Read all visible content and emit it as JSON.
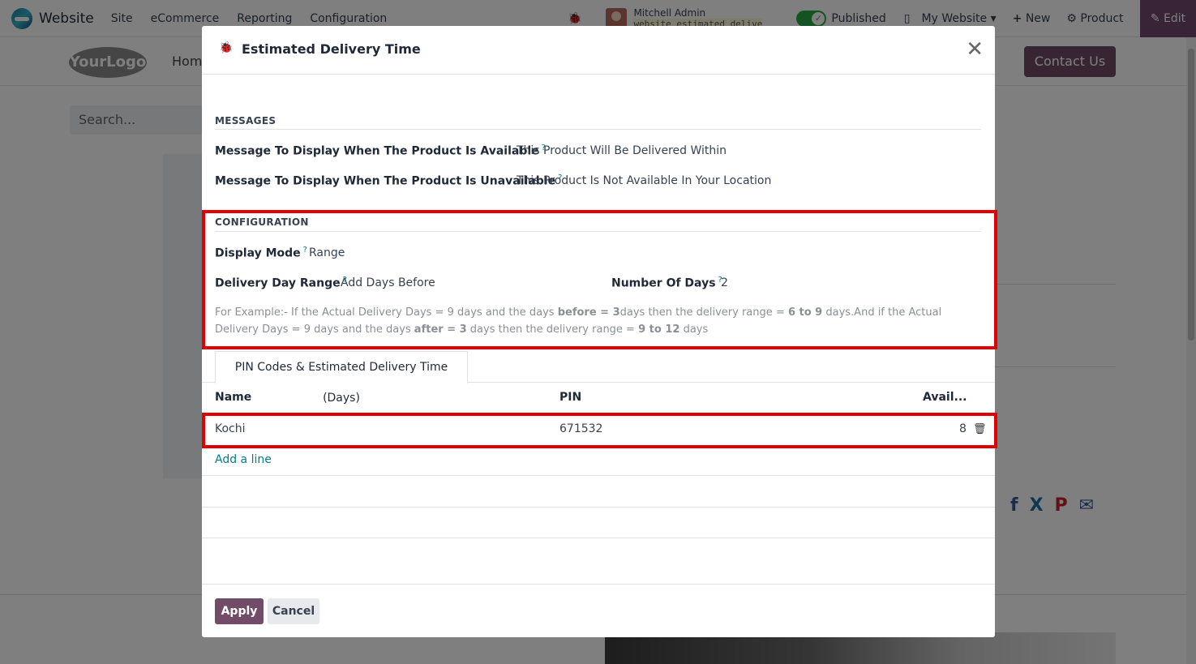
{
  "topbar": {
    "app_name": "Website",
    "menu": [
      "Site",
      "eCommerce",
      "Reporting",
      "Configuration"
    ],
    "user_name": "Mitchell Admin",
    "db_name": "website_estimated_delive",
    "published_label": "Published",
    "website_label": "My Website",
    "new_label": "New",
    "product_label": "Product",
    "edit_label": "Edit"
  },
  "site": {
    "logo_text": "YourLogo",
    "home_label": "Home",
    "contact_label": "Contact Us",
    "search_placeholder": "Search..."
  },
  "modal": {
    "title": "Estimated Delivery Time",
    "messages": {
      "section": "MESSAGES",
      "available_label": "Message To Display When The Product Is Available",
      "available_value": "This Product Will Be Delivered Within",
      "unavailable_label": "Message To Display When The Product Is Unavailable",
      "unavailable_value": "This Product Is Not Available In Your Location"
    },
    "configuration": {
      "section": "CONFIGURATION",
      "display_mode_label": "Display Mode",
      "display_mode_value": "Range",
      "day_range_label": "Delivery Day Range",
      "day_range_value": "Add Days Before",
      "num_days_label": "Number Of Days",
      "num_days_value": "2",
      "help_1": "For Example:- If the Actual Delivery Days = 9 days and the days ",
      "help_b1": "before = 3",
      "help_2": "days then the delivery range = ",
      "help_b2": "6 to 9",
      "help_3": " days.And if the Actual Delivery Days = 9 days and the days ",
      "help_b3": "after = 3",
      "help_4": " days then the delivery range = ",
      "help_b4": "9 to 12",
      "help_5": " days"
    },
    "tab_label": "PIN Codes & Estimated Delivery Time (Days)",
    "table": {
      "headers": [
        "Name",
        "PIN",
        "Avail..."
      ],
      "rows": [
        {
          "name": "Kochi",
          "pin": "671532",
          "avail": "8"
        }
      ],
      "add_line": "Add a line"
    },
    "apply_label": "Apply",
    "cancel_label": "Cancel"
  },
  "colors": {
    "brand": "#714b67",
    "accent": "#017e84",
    "highlight": "#e00000"
  }
}
